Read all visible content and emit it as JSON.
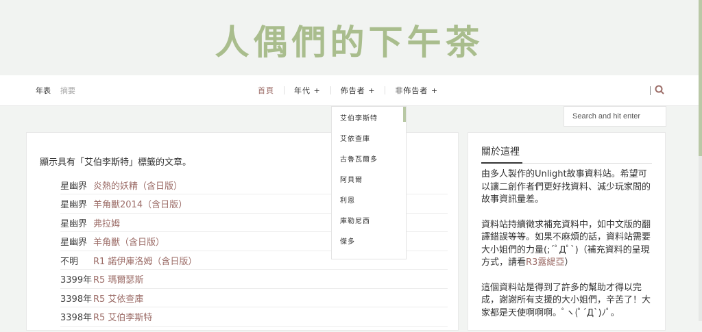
{
  "site": {
    "title": "人偶們的下午茶"
  },
  "nav": {
    "left": [
      "年表",
      "摘要"
    ],
    "center": [
      "首頁",
      "年代 +",
      "佈告者 +",
      "非佈告者 +"
    ]
  },
  "search": {
    "placeholder": "Search and hit enter"
  },
  "dropdown": {
    "items": [
      "艾伯李斯特",
      "艾依查庫",
      "古魯瓦爾多",
      "阿貝爾",
      "利恩",
      "庫勒尼西",
      "傑多"
    ]
  },
  "main": {
    "intro": "顯示具有「艾伯李斯特」標籤的文章。",
    "posts": [
      {
        "era": "星幽界",
        "title": "炎熱的妖精（含日版）"
      },
      {
        "era": "星幽界",
        "title": "羊角獸2014（含日版）"
      },
      {
        "era": "星幽界",
        "title": "弗拉姆"
      },
      {
        "era": "星幽界",
        "title": "羊角獸（含日版）"
      },
      {
        "era": "不明",
        "title": "R1 諾伊庫洛姆（含日版）"
      },
      {
        "era": "3399年",
        "title": "R5 瑪爾瑟斯"
      },
      {
        "era": "3398年",
        "title": "R5 艾依查庫"
      },
      {
        "era": "3398年",
        "title": "R5 艾伯李斯特"
      }
    ]
  },
  "sidebar": {
    "title": "關於這裡",
    "p1": "由多人製作的Unlight故事資料站。希望可以讓二創作者們更好找資料、減少玩家間的故事資訊量差。",
    "p2a": "資料站持續徵求補充資料中，如中文版的翻譯錯誤等等。如果不麻煩的話，資料站需要大小姐們的力量(;´ﾟДﾟ`)（補充資料的呈現方式，請看",
    "p2link": "R3露緹亞",
    "p2b": "）",
    "p3": "這個資料站是得到了許多的幫助才得以完成，謝謝所有支援的大小姐們，辛苦了！大家都是天使啊啊啊。ﾟヽ(ﾟ´Д`)ﾉﾟ。"
  },
  "colors": {
    "accent": "#9b6b66",
    "brand": "#a9bd8d"
  },
  "icons": {
    "search": "search-icon"
  }
}
